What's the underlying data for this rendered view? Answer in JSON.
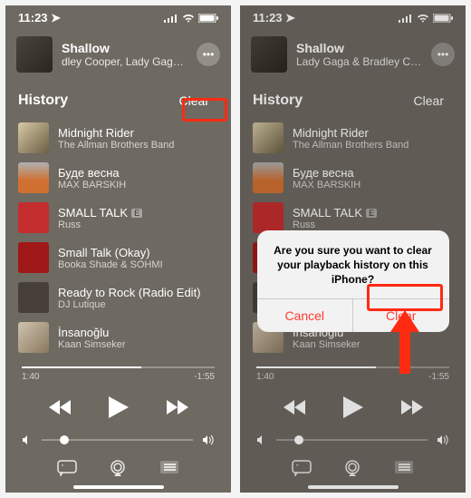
{
  "status": {
    "time": "11:23",
    "nav_icon": "location-arrow-icon"
  },
  "now_playing": {
    "title": "Shallow",
    "artist_left": "dley Cooper,     Lady Gaga &",
    "artist_right": "Lady Gaga & Bradley Cooper"
  },
  "history": {
    "label": "History",
    "clear_label": "Clear",
    "tracks": [
      {
        "title": "Midnight Rider",
        "artist": "The Allman Brothers Band"
      },
      {
        "title": "Буде весна",
        "artist": "MAX BARSKIH"
      },
      {
        "title": "SMALL TALK",
        "artist": "Russ",
        "explicit": true
      },
      {
        "title": "Small Talk (Okay)",
        "artist": "Booka Shade & SOHMI"
      },
      {
        "title": "Ready to Rock (Radio Edit)",
        "artist": "DJ Lutique"
      },
      {
        "title": "İnsanoğlu",
        "artist": "Kaan Simseker"
      }
    ]
  },
  "scrubber": {
    "elapsed": "1:40",
    "remaining": "-1:55",
    "progress_pct": 62
  },
  "dialog": {
    "message": "Are you sure you want to clear your playback history on this iPhone?",
    "cancel_label": "Cancel",
    "confirm_label": "Clear"
  },
  "colors": {
    "highlight": "#ff2a12",
    "destructive": "#ff3b30"
  }
}
